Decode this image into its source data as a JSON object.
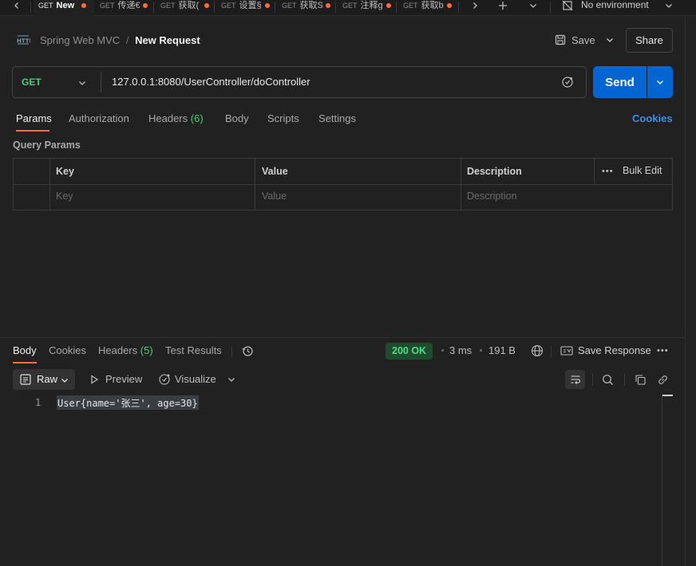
{
  "tabs": [
    {
      "method": "GET",
      "label": "New",
      "active": true
    },
    {
      "method": "GET",
      "label": "传递€"
    },
    {
      "method": "GET",
      "label": "获取("
    },
    {
      "method": "GET",
      "label": "设置§"
    },
    {
      "method": "GET",
      "label": "获取S"
    },
    {
      "method": "GET",
      "label": "注释g"
    },
    {
      "method": "GET",
      "label": "获取b"
    }
  ],
  "environment": "No environment",
  "breadcrumb": {
    "collection": "Spring Web MVC",
    "separator": "/",
    "request": "New Request",
    "http_icon": "HTTP"
  },
  "header_actions": {
    "save": "Save",
    "share": "Share"
  },
  "request": {
    "method": "GET",
    "url": "127.0.0.1:8080/UserController/doController",
    "send": "Send"
  },
  "request_tabs": {
    "params": "Params",
    "authorization": "Authorization",
    "headers": "Headers",
    "headers_count": "(6)",
    "body": "Body",
    "scripts": "Scripts",
    "settings": "Settings",
    "cookies": "Cookies"
  },
  "query_params": {
    "title": "Query Params",
    "columns": {
      "key": "Key",
      "value": "Value",
      "description": "Description",
      "bulk_edit": "Bulk Edit"
    },
    "placeholders": {
      "key": "Key",
      "value": "Value",
      "description": "Description"
    }
  },
  "response_tabs": {
    "body": "Body",
    "cookies": "Cookies",
    "headers": "Headers",
    "headers_count": "(5)",
    "test_results": "Test Results"
  },
  "response_meta": {
    "status": "200 OK",
    "time": "3 ms",
    "size": "191 B",
    "save_response": "Save Response"
  },
  "response_view": {
    "raw": "Raw",
    "preview": "Preview",
    "visualize": "Visualize"
  },
  "response_body": {
    "line_number": "1",
    "content": "User{name='张三', age=30}"
  },
  "colors": {
    "accent": "#0265d2",
    "status_bg": "#1e4d2b",
    "status_text": "#57d68d",
    "get": "#4bc97c",
    "tab_dot": "#ff6c37"
  }
}
